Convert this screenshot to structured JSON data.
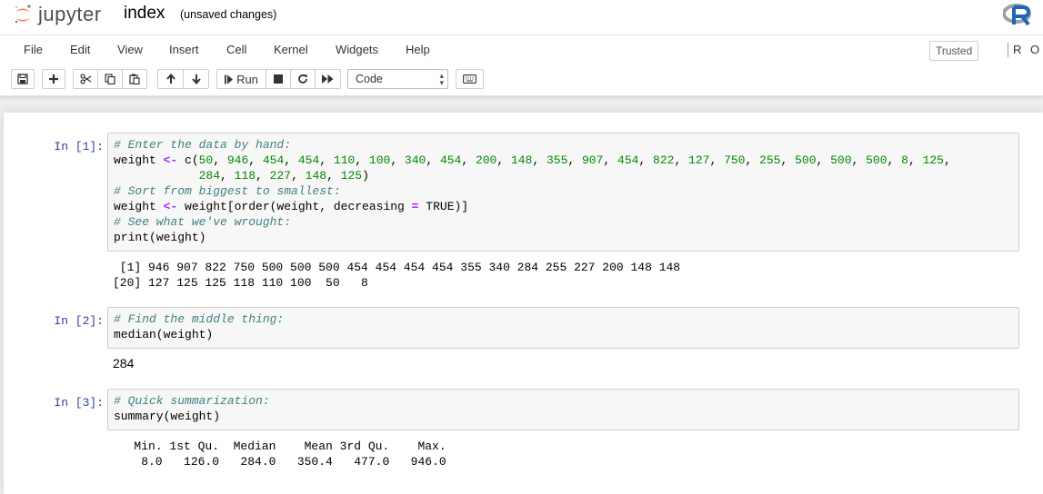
{
  "header": {
    "logo_text": "jupyter",
    "notebook_name": "index",
    "save_status": "(unsaved changes)"
  },
  "menu": {
    "items": [
      "File",
      "Edit",
      "View",
      "Insert",
      "Cell",
      "Kernel",
      "Widgets",
      "Help"
    ],
    "trusted_label": "Trusted",
    "kernel_label": "R O"
  },
  "toolbar": {
    "run_label": "Run",
    "cell_type": "Code",
    "icons": [
      "save-icon",
      "plus-icon",
      "cut-icon",
      "copy-icon",
      "paste-icon",
      "arrow-up-icon",
      "arrow-down-icon",
      "step-forward-icon",
      "stop-icon",
      "restart-icon",
      "fast-forward-icon",
      "keyboard-icon"
    ]
  },
  "cells": [
    {
      "prompt": "In [1]:",
      "lines": [
        "# Enter the data by hand:",
        "weight <- c(50, 946, 454, 454, 110, 100, 340, 454, 200, 148, 355, 907, 454, 822, 127, 750, 255, 500, 500, 500, 8, 125,",
        "            284, 118, 227, 148, 125)",
        "# Sort from biggest to smallest:",
        "weight <- weight[order(weight, decreasing = TRUE)]",
        "# See what we've wrought:",
        "print(weight)"
      ],
      "output": [
        " [1] 946 907 822 750 500 500 500 454 454 454 454 355 340 284 255 227 200 148 148",
        "[20] 127 125 125 118 110 100  50   8"
      ]
    },
    {
      "prompt": "In [2]:",
      "lines": [
        "# Find the middle thing:",
        "median(weight)"
      ],
      "output": [
        "284"
      ]
    },
    {
      "prompt": "In [3]:",
      "lines": [
        "# Quick summarization:",
        "summary(weight)"
      ],
      "output": [
        "   Min. 1st Qu.  Median    Mean 3rd Qu.    Max. ",
        "    8.0   126.0   284.0   350.4   477.0   946.0 "
      ]
    }
  ],
  "colors": {
    "prompt": "#303f9f",
    "comment": "#408080",
    "number": "#008800",
    "operator": "#aa22ff",
    "jupyter_orange": "#f37726"
  }
}
